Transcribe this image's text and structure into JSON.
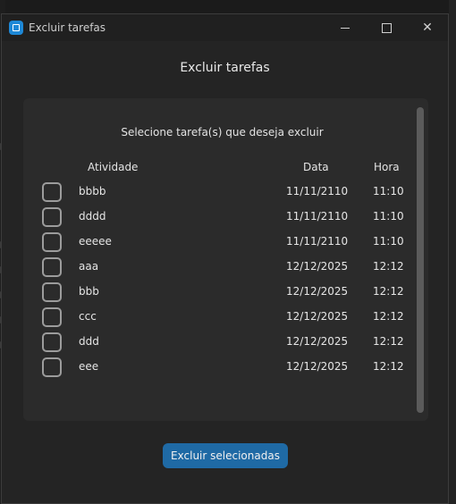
{
  "window": {
    "title": "Excluir tarefas",
    "controls": {
      "minimize": "minimize",
      "maximize": "maximize",
      "close": "✕"
    }
  },
  "dialog": {
    "heading": "Excluir tarefas",
    "instruction": "Selecione tarefa(s) que deseja excluir",
    "columns": {
      "atividade": "Atividade",
      "data": "Data",
      "hora": "Hora"
    },
    "rows": [
      {
        "atividade": "bbbb",
        "data": "11/11/2110",
        "hora": "11:10",
        "checked": false
      },
      {
        "atividade": "dddd",
        "data": "11/11/2110",
        "hora": "11:10",
        "checked": false
      },
      {
        "atividade": "eeeee",
        "data": "11/11/2110",
        "hora": "11:10",
        "checked": false
      },
      {
        "atividade": "aaa",
        "data": "12/12/2025",
        "hora": "12:12",
        "checked": false
      },
      {
        "atividade": "bbb",
        "data": "12/12/2025",
        "hora": "12:12",
        "checked": false
      },
      {
        "atividade": "ccc",
        "data": "12/12/2025",
        "hora": "12:12",
        "checked": false
      },
      {
        "atividade": "ddd",
        "data": "12/12/2025",
        "hora": "12:12",
        "checked": false
      },
      {
        "atividade": "eee",
        "data": "12/12/2025",
        "hora": "12:12",
        "checked": false
      }
    ],
    "delete_button": "Excluir selecionadas"
  },
  "colors": {
    "accent": "#1f6aa5",
    "app_icon": "#1e88d6",
    "panel": "#2b2b2b",
    "window": "#242424"
  }
}
